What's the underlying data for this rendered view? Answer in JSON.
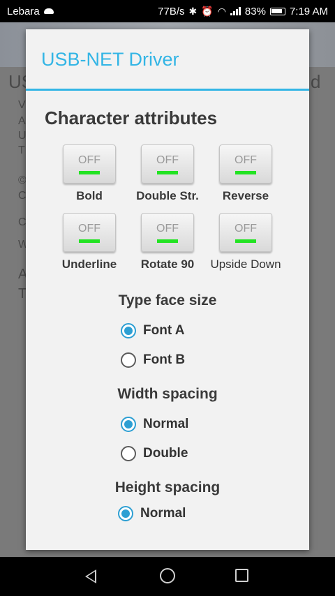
{
  "status_bar": {
    "carrier": "Lebara",
    "net_speed": "77B/s",
    "battery": "83%",
    "time": "7:19 AM",
    "icons": [
      "cloud-icon",
      "bluetooth-icon",
      "alarm-icon",
      "wifi-icon",
      "signal-icon",
      "battery-icon"
    ]
  },
  "background": {
    "fragments": [
      "US",
      "d",
      "V",
      "A",
      "U",
      "T",
      "©",
      "C",
      "C",
      "W",
      "A",
      "T"
    ]
  },
  "dialog": {
    "title": "USB-NET Driver",
    "section_title": "Character attributes",
    "toggles": [
      {
        "state": "OFF",
        "label": "Bold"
      },
      {
        "state": "OFF",
        "label": "Double Str."
      },
      {
        "state": "OFF",
        "label": "Reverse"
      },
      {
        "state": "OFF",
        "label": "Underline"
      },
      {
        "state": "OFF",
        "label": "Rotate 90"
      },
      {
        "state": "OFF",
        "label": "Upside Down"
      }
    ],
    "type_face": {
      "heading": "Type face size",
      "options": [
        "Font A",
        "Font B"
      ],
      "selected": "Font A"
    },
    "width_spacing": {
      "heading": "Width spacing",
      "options": [
        "Normal",
        "Double"
      ],
      "selected": "Normal"
    },
    "height_spacing": {
      "heading": "Height spacing",
      "options": [
        "Normal"
      ],
      "selected": "Normal"
    },
    "colors": {
      "accent": "#33b5e5",
      "indicator": "#22e322",
      "radio": "#2d9fd3"
    }
  },
  "nav_bar": {
    "icons": [
      "back-icon",
      "home-icon",
      "recents-icon"
    ]
  }
}
